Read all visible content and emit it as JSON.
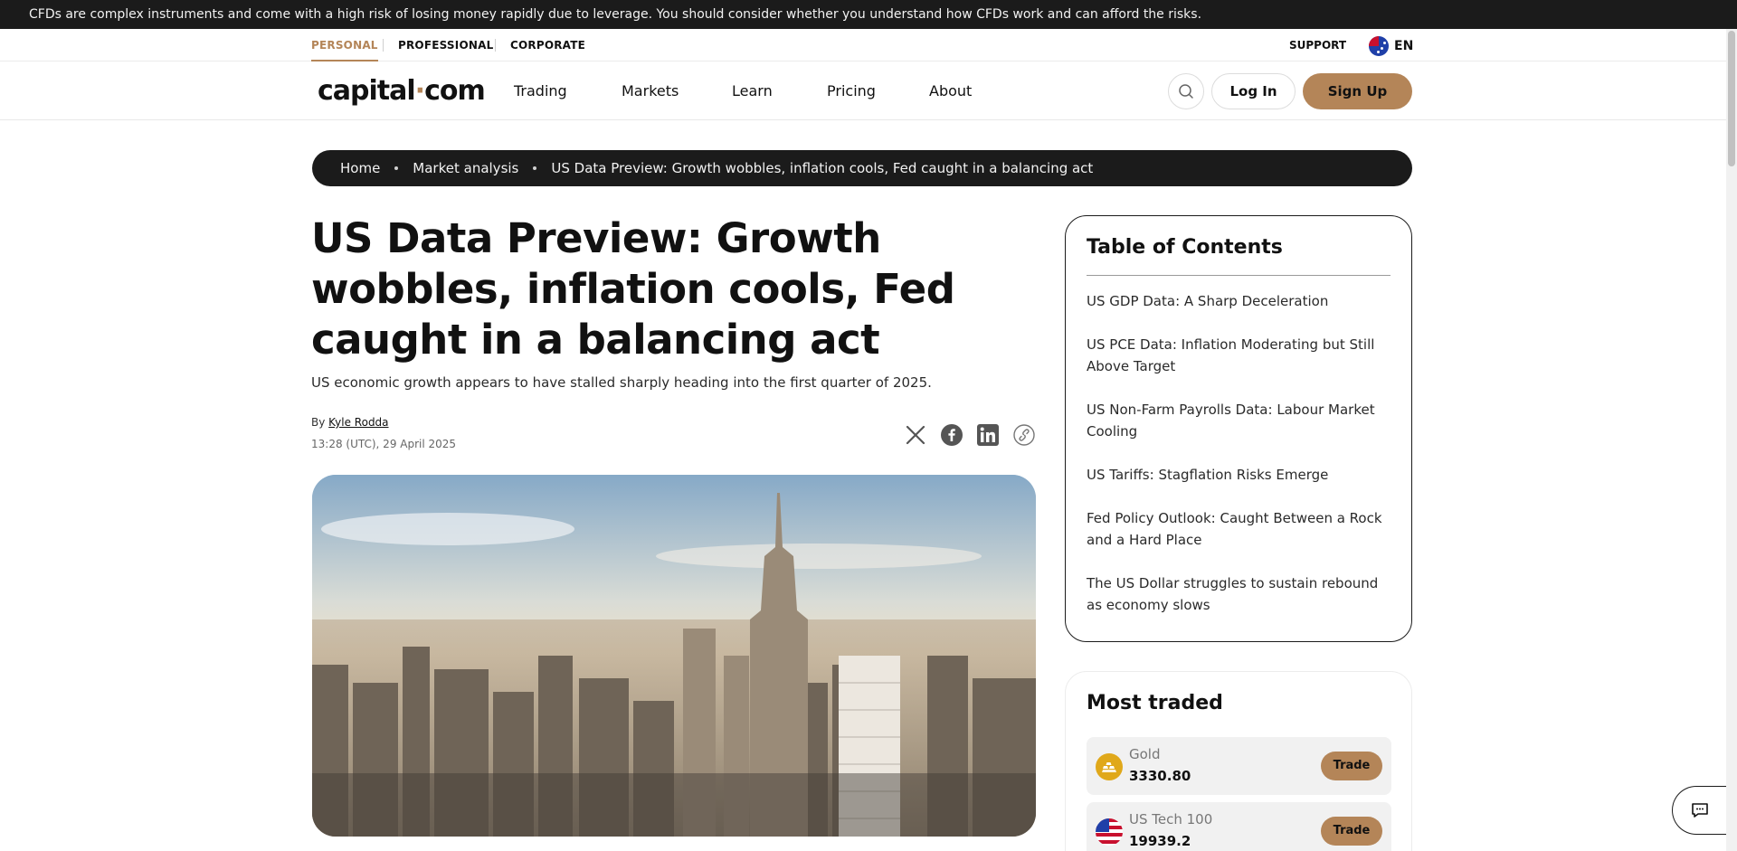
{
  "risk_warning": "CFDs are complex instruments and come with a high risk of losing money rapidly due to leverage. You should consider whether you understand how CFDs work and can afford the risks.",
  "segments": [
    "PERSONAL",
    "PROFESSIONAL",
    "CORPORATE"
  ],
  "support_label": "SUPPORT",
  "language": "EN",
  "logo": {
    "part1": "capital",
    "dot": "·",
    "part2": "com"
  },
  "nav": [
    "Trading",
    "Markets",
    "Learn",
    "Pricing",
    "About"
  ],
  "actions": {
    "login": "Log In",
    "signup": "Sign Up"
  },
  "breadcrumb": [
    "Home",
    "Market analysis",
    "US Data Preview: Growth wobbles, inflation cools, Fed caught in a balancing act"
  ],
  "article": {
    "title": "US Data Preview: Growth wobbles, inflation cools, Fed caught in a balancing act",
    "subtitle": "US economic growth appears to have stalled sharply heading into the first quarter of 2025.",
    "by": "By",
    "author": "Kyle Rodda",
    "date": "13:28 (UTC), 29 April 2025"
  },
  "share_icons": [
    "x-icon",
    "facebook-icon",
    "linkedin-icon",
    "link-icon"
  ],
  "toc": {
    "title": "Table of Contents",
    "items": [
      "US GDP Data: A Sharp Deceleration",
      "US PCE Data: Inflation Moderating but Still Above Target",
      "US Non-Farm Payrolls Data: Labour Market Cooling",
      "US Tariffs: Stagflation Risks Emerge",
      "Fed Policy Outlook: Caught Between a Rock and a Hard Place",
      "The US Dollar struggles to sustain rebound as economy slows"
    ]
  },
  "most_traded": {
    "title": "Most traded",
    "items": [
      {
        "name": "Gold",
        "price": "3330.80",
        "action": "Trade",
        "icon": "gold-bars-icon"
      },
      {
        "name": "US Tech 100",
        "price": "19939.2",
        "action": "Trade",
        "icon": "us-flag-icon"
      }
    ]
  },
  "colors": {
    "accent": "#b48558",
    "dark": "#1b1b1b",
    "text": "#111111"
  }
}
